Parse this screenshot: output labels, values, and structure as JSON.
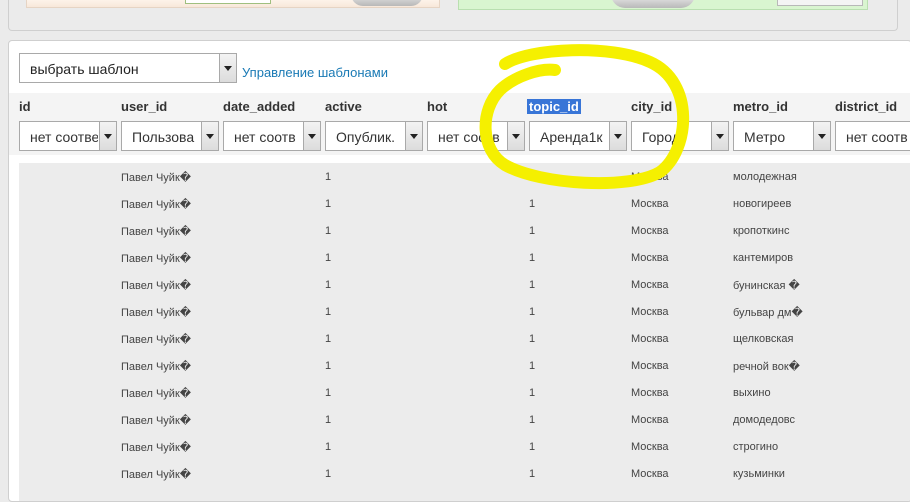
{
  "template": {
    "select_value": "выбрать шаблон",
    "manage_link": "Управление шаблонами"
  },
  "columns": [
    {
      "key": "id",
      "label": "id",
      "filter": "нет соотве"
    },
    {
      "key": "user_id",
      "label": "user_id",
      "filter": "Пользова"
    },
    {
      "key": "date_added",
      "label": "date_added",
      "filter": "нет соотв"
    },
    {
      "key": "active",
      "label": "active",
      "filter": "Опублик."
    },
    {
      "key": "hot",
      "label": "hot",
      "filter": "нет соотв"
    },
    {
      "key": "topic_id",
      "label": "topic_id",
      "filter": "Аренда1к"
    },
    {
      "key": "city_id",
      "label": "city_id",
      "filter": "Город"
    },
    {
      "key": "metro_id",
      "label": "metro_id",
      "filter": "Метро"
    },
    {
      "key": "district_id",
      "label": "district_id",
      "filter": "нет соотв"
    }
  ],
  "selected_column": "topic_id",
  "rows": [
    {
      "user": "Павел Чуйк�",
      "active": "1",
      "topic": "1",
      "city": "Москва",
      "metro": "молодежная"
    },
    {
      "user": "Павел Чуйк�",
      "active": "1",
      "topic": "1",
      "city": "Москва",
      "metro": "новогиреев"
    },
    {
      "user": "Павел Чуйк�",
      "active": "1",
      "topic": "1",
      "city": "Москва",
      "metro": "кропоткинс"
    },
    {
      "user": "Павел Чуйк�",
      "active": "1",
      "topic": "1",
      "city": "Москва",
      "metro": "кантемиров"
    },
    {
      "user": "Павел Чуйк�",
      "active": "1",
      "topic": "1",
      "city": "Москва",
      "metro": "бунинская �"
    },
    {
      "user": "Павел Чуйк�",
      "active": "1",
      "topic": "1",
      "city": "Москва",
      "metro": "бульвар дм�"
    },
    {
      "user": "Павел Чуйк�",
      "active": "1",
      "topic": "1",
      "city": "Москва",
      "metro": "щелковская"
    },
    {
      "user": "Павел Чуйк�",
      "active": "1",
      "topic": "1",
      "city": "Москва",
      "metro": "речной вок�"
    },
    {
      "user": "Павел Чуйк�",
      "active": "1",
      "topic": "1",
      "city": "Москва",
      "metro": "выхино"
    },
    {
      "user": "Павел Чуйк�",
      "active": "1",
      "topic": "1",
      "city": "Москва",
      "metro": "домодедовс"
    },
    {
      "user": "Павел Чуйк�",
      "active": "1",
      "topic": "1",
      "city": "Москва",
      "metro": "строгино"
    },
    {
      "user": "Павел Чуйк�",
      "active": "1",
      "topic": "1",
      "city": "Москва",
      "metro": "кузьминки"
    }
  ],
  "colors": {
    "annotation": "#f5f000",
    "link": "#1a7ab5",
    "selection": "#3875d7"
  },
  "icons": {
    "dropdown": "chevron-down-icon"
  }
}
